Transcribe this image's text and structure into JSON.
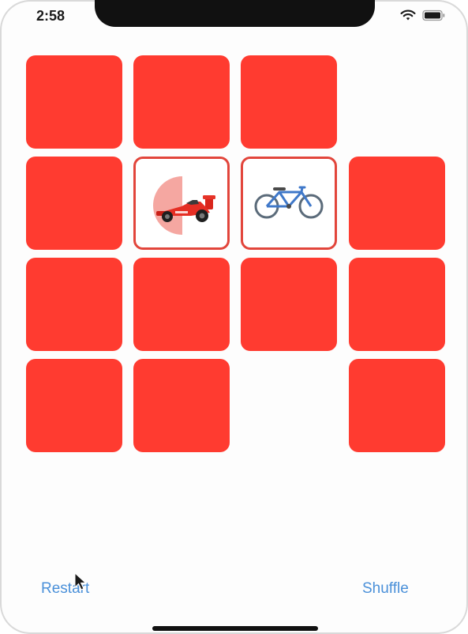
{
  "status_bar": {
    "time": "2:58",
    "icons": [
      "wifi-icon",
      "battery-icon"
    ]
  },
  "colors": {
    "card_back": "#ff3b30",
    "card_border": "#e2453b",
    "button_text": "#4a90d9"
  },
  "cards": [
    {
      "state": "face-down",
      "emoji": ""
    },
    {
      "state": "face-down",
      "emoji": ""
    },
    {
      "state": "face-down",
      "emoji": ""
    },
    {
      "state": "matched",
      "emoji": ""
    },
    {
      "state": "face-down",
      "emoji": ""
    },
    {
      "state": "face-up",
      "emoji": "🏎",
      "icon": "race-car-icon"
    },
    {
      "state": "face-up",
      "emoji": "🚲",
      "icon": "bicycle-icon"
    },
    {
      "state": "face-down",
      "emoji": ""
    },
    {
      "state": "face-down",
      "emoji": ""
    },
    {
      "state": "face-down",
      "emoji": ""
    },
    {
      "state": "face-down",
      "emoji": ""
    },
    {
      "state": "face-down",
      "emoji": ""
    },
    {
      "state": "face-down",
      "emoji": ""
    },
    {
      "state": "face-down",
      "emoji": ""
    },
    {
      "state": "matched",
      "emoji": ""
    },
    {
      "state": "face-down",
      "emoji": ""
    }
  ],
  "toolbar": {
    "restart_label": "Restart",
    "shuffle_label": "Shuffle"
  }
}
